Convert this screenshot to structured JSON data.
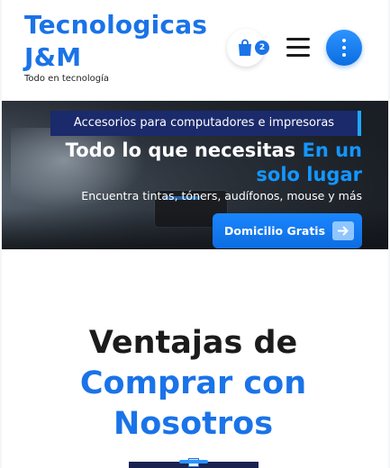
{
  "header": {
    "brand_title": "Tecnologicas J&M",
    "tagline": "Todo en tecnología",
    "cart_count": "2",
    "icons": [
      "shopping-bag-icon",
      "hamburger-menu-icon",
      "vertical-dots-icon"
    ]
  },
  "hero": {
    "tag": "Accesorios para computadores e impresoras",
    "heading_white": "Todo lo que necesitas ",
    "heading_accent": "En un solo lugar",
    "subheading": "Encuentra tintas, tóners, audífonos, mouse y más",
    "cta_label": "Domicilio Gratis",
    "cta_icon": "arrow-right-icon"
  },
  "advantages": {
    "title_line1": "Ventajas de",
    "title_line2": "Comprar con Nosotros"
  },
  "colors": {
    "brand_blue": "#1a73e8",
    "accent_blue": "#1496ff",
    "tag_bg": "#1b2a6b",
    "dark_text": "#1b1b1b"
  }
}
